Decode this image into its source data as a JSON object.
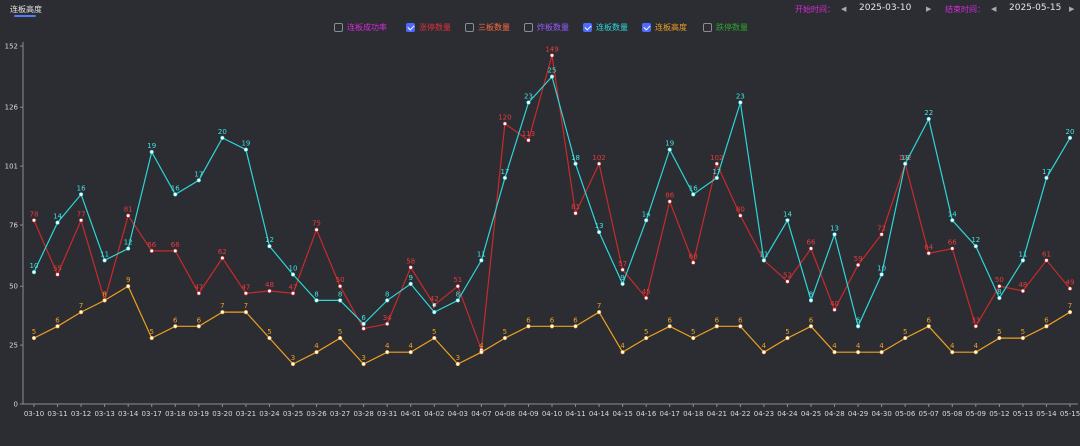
{
  "header": {
    "tab_label": "连板高度",
    "start_label": "开始时间：",
    "start_date": "2025-03-10",
    "end_label": "结束时间：",
    "end_date": "2025-05-15",
    "prev_icon": "triangle-left-icon",
    "next_icon": "triangle-right-icon"
  },
  "legend": [
    {
      "label": "连板成功率",
      "checked": false,
      "color": "#d62bd6"
    },
    {
      "label": "涨停数量",
      "checked": true,
      "color": "#e0303a"
    },
    {
      "label": "三板数量",
      "checked": false,
      "color": "#ff6a3d"
    },
    {
      "label": "炸板数量",
      "checked": false,
      "color": "#9b59ff"
    },
    {
      "label": "连板数量",
      "checked": true,
      "color": "#2ed6d6"
    },
    {
      "label": "连板高度",
      "checked": true,
      "color": "#f0a020"
    },
    {
      "label": "跌停数量",
      "checked": false,
      "color": "#2fa52f"
    }
  ],
  "chart_data": {
    "type": "line",
    "y_ticks": [
      0,
      25,
      50,
      76,
      101,
      126,
      152
    ],
    "ylim": [
      0,
      152
    ],
    "grid": false,
    "categories": [
      "03-10",
      "03-11",
      "03-12",
      "03-13",
      "03-14",
      "03-17",
      "03-18",
      "03-19",
      "03-20",
      "03-21",
      "03-24",
      "03-25",
      "03-26",
      "03-27",
      "03-28",
      "03-31",
      "04-01",
      "04-02",
      "04-03",
      "04-07",
      "04-08",
      "04-09",
      "04-10",
      "04-11",
      "04-14",
      "04-15",
      "04-16",
      "04-17",
      "04-18",
      "04-21",
      "04-22",
      "04-23",
      "04-24",
      "04-25",
      "04-28",
      "04-29",
      "04-30",
      "05-06",
      "05-07",
      "05-08",
      "05-09",
      "05-12",
      "05-13",
      "05-14",
      "05-15"
    ],
    "series": [
      {
        "name": "涨停数量",
        "color": "#c92a2a",
        "label_color": "#e83a3a",
        "values": [
          78,
          55,
          78,
          44,
          80,
          65,
          65,
          47,
          62,
          47,
          48,
          47,
          74,
          50,
          32,
          34,
          58,
          42,
          50,
          23,
          119,
          112,
          148,
          81,
          102,
          57,
          45,
          86,
          60,
          102,
          80,
          61,
          52,
          66,
          40,
          59,
          72,
          102,
          64,
          66,
          33,
          50,
          48,
          61,
          49
        ],
        "labels": [
          "78",
          "55",
          "77",
          "",
          "81",
          "66",
          "66",
          "47",
          "62",
          "47",
          "48",
          "47",
          "75",
          "50",
          "",
          "34",
          "58",
          "42",
          "51",
          "",
          "120",
          "113",
          "149",
          "81",
          "102",
          "57",
          "45",
          "86",
          "60",
          "102",
          "80",
          "",
          "52",
          "66",
          "40",
          "59",
          "72",
          "102",
          "64",
          "66",
          "33",
          "50",
          "48",
          "61",
          "49"
        ]
      },
      {
        "name": "连板数量",
        "color": "#2ed6d6",
        "label_color": "#3fe3e3",
        "values": [
          56,
          77,
          89,
          61,
          66,
          107,
          89,
          95,
          113,
          108,
          67,
          55,
          44,
          44,
          34,
          44,
          51,
          39,
          44,
          61,
          96,
          128,
          139,
          102,
          73,
          51,
          78,
          108,
          89,
          96,
          128,
          61,
          78,
          44,
          72,
          33,
          55,
          102,
          121,
          78,
          67,
          45,
          61,
          96,
          113
        ],
        "labels": [
          "10",
          "14",
          "16",
          "11",
          "12",
          "19",
          "16",
          "17",
          "20",
          "19",
          "12",
          "10",
          "8",
          "8",
          "6",
          "8",
          "9",
          "7",
          "8",
          "11",
          "17",
          "23",
          "25",
          "18",
          "13",
          "9",
          "14",
          "19",
          "16",
          "17",
          "23",
          "11",
          "14",
          "8",
          "13",
          "6",
          "10",
          "18",
          "22",
          "14",
          "12",
          "8",
          "11",
          "17",
          "20"
        ]
      },
      {
        "name": "连板高度",
        "color": "#f0a020",
        "label_color": "#f0a020",
        "values": [
          28,
          33,
          39,
          44,
          50,
          28,
          33,
          33,
          39,
          39,
          28,
          17,
          22,
          28,
          17,
          22,
          22,
          28,
          17,
          22,
          28,
          33,
          33,
          33,
          39,
          22,
          28,
          33,
          28,
          33,
          33,
          22,
          28,
          33,
          22,
          22,
          22,
          28,
          33,
          22,
          22,
          28,
          28,
          33,
          39
        ],
        "labels": [
          "5",
          "6",
          "7",
          "8",
          "9",
          "5",
          "6",
          "6",
          "7",
          "7",
          "5",
          "3",
          "4",
          "5",
          "3",
          "4",
          "4",
          "5",
          "3",
          "4",
          "5",
          "6",
          "6",
          "6",
          "7",
          "4",
          "5",
          "6",
          "5",
          "6",
          "6",
          "4",
          "5",
          "6",
          "4",
          "4",
          "4",
          "5",
          "6",
          "4",
          "4",
          "5",
          "5",
          "6",
          "7"
        ]
      }
    ]
  }
}
